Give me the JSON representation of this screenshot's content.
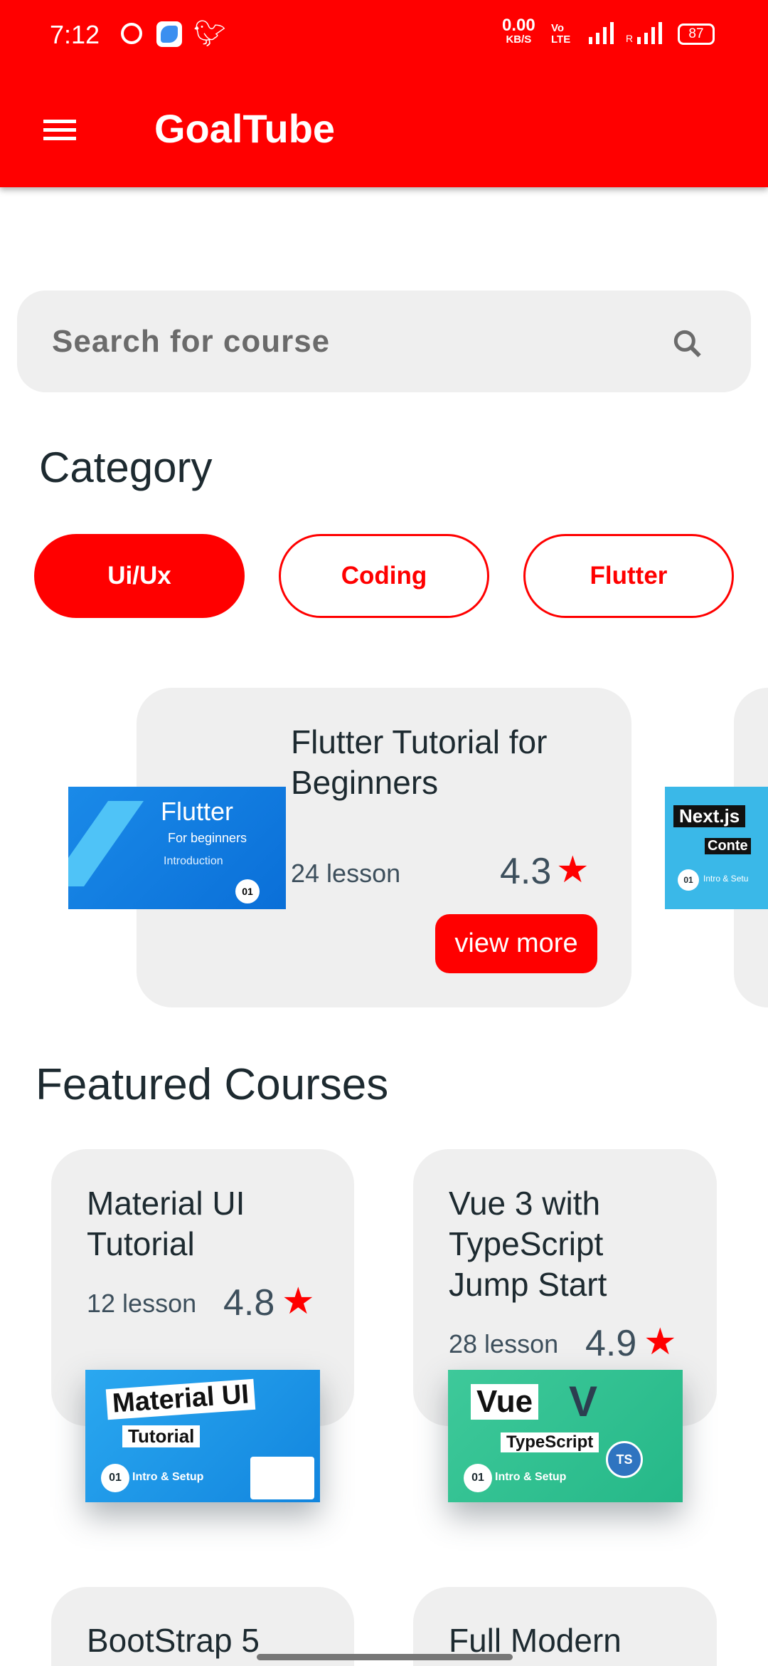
{
  "status_bar": {
    "time": "7:12",
    "net_speed": "0.00",
    "net_unit": "KB/S",
    "volte": "Vo LTE",
    "roaming": "R",
    "battery": "87",
    "notif_icons": [
      "whatsapp-icon",
      "app-icon",
      "twitter-icon"
    ]
  },
  "app_bar": {
    "title": "GoalTube",
    "menu_icon": "hamburger-menu-icon"
  },
  "search": {
    "placeholder": "Search for course",
    "icon": "search-icon"
  },
  "category": {
    "heading": "Category",
    "chips": [
      {
        "label": "Ui/Ux",
        "active": true
      },
      {
        "label": "Coding",
        "active": false
      },
      {
        "label": "Flutter",
        "active": false
      }
    ]
  },
  "carousel": [
    {
      "title": "Flutter Tutorial for Beginners",
      "lessons": "24 lesson",
      "rating": "4.3",
      "button": "view more",
      "thumb": {
        "title": "Flutter",
        "subtitle": "For beginners",
        "caption": "Introduction",
        "number": "01"
      }
    },
    {
      "thumb": {
        "title": "Next.js",
        "subtitle": "Conte",
        "caption": "Intro & Setu",
        "number": "01"
      }
    }
  ],
  "featured": {
    "heading": "Featured Courses",
    "courses": [
      {
        "title": "Material UI Tutorial",
        "lessons": "12 lesson",
        "rating": "4.8",
        "thumb": {
          "title": "Material UI",
          "subtitle": "Tutorial",
          "caption": "Intro & Setup",
          "number": "01"
        }
      },
      {
        "title": "Vue 3 with TypeScript Jump Start",
        "lessons": "28 lesson",
        "rating": "4.9",
        "thumb": {
          "title": "Vue",
          "subtitle": "TypeScript",
          "caption": "Intro & Setup",
          "number": "01",
          "badge": "TS"
        }
      },
      {
        "title": "BootStrap 5"
      },
      {
        "title": "Full Modern"
      }
    ]
  },
  "colors": {
    "primary": "#ff0000",
    "card_bg": "#efefef",
    "text_dark": "#1d2a30",
    "text_muted": "#3d4f5c"
  }
}
